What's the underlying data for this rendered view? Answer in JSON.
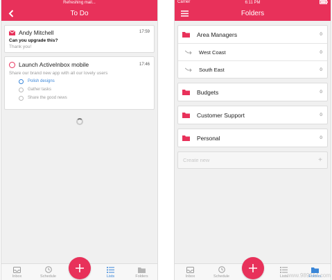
{
  "colors": {
    "accent": "#e8315a",
    "active_tab": "#3a86d8"
  },
  "left": {
    "status": "Refreshing mail...",
    "title": "To Do",
    "mail": {
      "sender": "Andy Mitchell",
      "time": "17:59",
      "subject": "Can you upgrade this?",
      "preview": "Thank you!"
    },
    "task": {
      "title": "Launch ActiveInbox mobile",
      "time": "17:46",
      "description": "Share our brand new app with all our lovely users",
      "subtasks": [
        "Polish designs",
        "Gather tasks",
        "Share the good news"
      ]
    },
    "tabs": [
      "Inbox",
      "Schedule",
      "Lists",
      "Folders"
    ]
  },
  "right": {
    "status_left": "Carrier",
    "status_time": "6:11 PM",
    "title": "Folders",
    "groups": [
      {
        "label": "Area Managers",
        "count": "0",
        "children": [
          {
            "label": "West Coast",
            "count": "0"
          },
          {
            "label": "South East",
            "count": "0"
          }
        ]
      },
      {
        "label": "Budgets",
        "count": "0"
      },
      {
        "label": "Customer Support",
        "count": "0"
      },
      {
        "label": "Personal",
        "count": "0"
      }
    ],
    "create_placeholder": "Create new",
    "tabs": [
      "Inbox",
      "Schedule",
      "Lists",
      "Folders"
    ]
  },
  "watermark": "www.989214.com"
}
